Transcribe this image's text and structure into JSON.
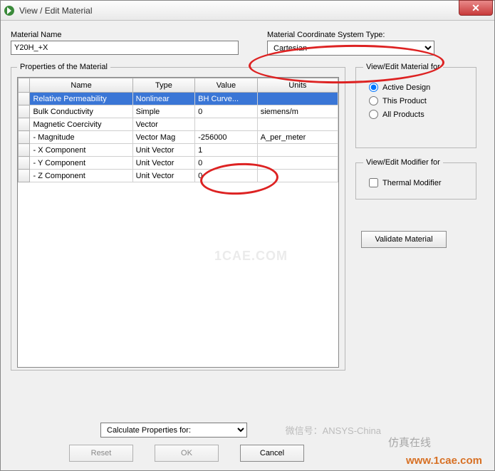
{
  "window": {
    "title": "View / Edit Material",
    "close_glyph": "✕"
  },
  "material_name": {
    "label": "Material Name",
    "value": "Y20H_+X"
  },
  "coord": {
    "label": "Material Coordinate System Type:",
    "value": "Cartesian"
  },
  "props_legend": "Properties of the Material",
  "table": {
    "headers": [
      "Name",
      "Type",
      "Value",
      "Units"
    ],
    "rows": [
      {
        "name": "Relative Permeability",
        "type": "Nonlinear",
        "value": "BH Curve...",
        "units": "",
        "selected": true
      },
      {
        "name": "Bulk Conductivity",
        "type": "Simple",
        "value": "0",
        "units": "siemens/m"
      },
      {
        "name": "Magnetic Coercivity",
        "type": "Vector",
        "value": "",
        "units": ""
      },
      {
        "name": "- Magnitude",
        "type": "Vector Mag",
        "value": "-256000",
        "units": "A_per_meter"
      },
      {
        "name": "- X Component",
        "type": "Unit Vector",
        "value": "1",
        "units": ""
      },
      {
        "name": "- Y Component",
        "type": "Unit Vector",
        "value": "0",
        "units": ""
      },
      {
        "name": "- Z Component",
        "type": "Unit Vector",
        "value": "0",
        "units": ""
      }
    ]
  },
  "view_edit": {
    "legend": "View/Edit Material for",
    "options": {
      "active": "Active Design",
      "product": "This Product",
      "all": "All Products"
    },
    "selected": "active"
  },
  "modifier": {
    "legend": "View/Edit Modifier for",
    "thermal": "Thermal Modifier"
  },
  "validate_label": "Validate Material",
  "calc": {
    "label": "Calculate Properties for:"
  },
  "buttons": {
    "reset": "Reset",
    "ok": "OK",
    "cancel": "Cancel"
  },
  "watermarks": {
    "center": "1CAE.COM",
    "wechat": "微信号：ANSYS-China",
    "cn": "仿真在线",
    "url": "www.1cae.com"
  }
}
